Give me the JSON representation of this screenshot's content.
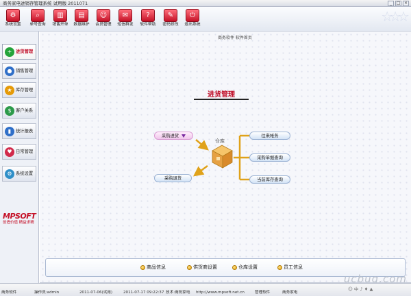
{
  "window": {
    "title": "商务家电进销存管理系统 试用版 2011071",
    "buttons": [
      "_",
      "□",
      "×"
    ]
  },
  "toolbar": {
    "items": [
      {
        "label": "系统设置",
        "icon": "gear-icon",
        "glyph": "⚙"
      },
      {
        "label": "单号查询",
        "icon": "magnifier-icon",
        "glyph": "⌕"
      },
      {
        "label": "销售开单",
        "icon": "chart-icon",
        "glyph": "▥"
      },
      {
        "label": "数据维护",
        "icon": "database-icon",
        "glyph": "▤"
      },
      {
        "label": "会员管理",
        "icon": "members-icon",
        "glyph": "☺"
      },
      {
        "label": "短信群发",
        "icon": "mail-icon",
        "glyph": "✉"
      },
      {
        "label": "软件帮助",
        "icon": "help-icon",
        "glyph": "?"
      },
      {
        "label": "密码修改",
        "icon": "lock-icon",
        "glyph": "✎"
      },
      {
        "label": "退出系统",
        "icon": "power-icon",
        "glyph": "⏻"
      }
    ]
  },
  "sidebar": {
    "items": [
      {
        "label": "进货管理",
        "icon": "plus-icon",
        "glyph": "+",
        "color": "#23a33a",
        "active": true
      },
      {
        "label": "销售管理",
        "icon": "sales-icon",
        "glyph": "●",
        "color": "#2f6fc8",
        "active": false
      },
      {
        "label": "库存管理",
        "icon": "star-icon",
        "glyph": "★",
        "color": "#e59a07",
        "active": false
      },
      {
        "label": "客户关系",
        "icon": "dollar-icon",
        "glyph": "$",
        "color": "#2c9a4a",
        "active": false
      },
      {
        "label": "统计报表",
        "icon": "report-icon",
        "glyph": "▮",
        "color": "#2f6fc8",
        "active": false
      },
      {
        "label": "日常管理",
        "icon": "heart-icon",
        "glyph": "♥",
        "color": "#d12a4b",
        "active": false
      },
      {
        "label": "系统设置",
        "icon": "settings-icon",
        "glyph": "⚙",
        "color": "#2f8fc8",
        "active": false
      }
    ],
    "logo": {
      "brand": "MPSOFT",
      "tagline": "创造价值 精益求精"
    }
  },
  "main": {
    "header": "商务软件 软件首页",
    "title": "进货管理",
    "diagram": {
      "center_label": "仓库",
      "purchase_in": "采购进货",
      "purchase_return": "采购退货",
      "right_items": [
        "往来帐务",
        "采购单据查询",
        "当前库存查询"
      ]
    },
    "bottom_links": [
      "商品信息",
      "供货商设置",
      "仓库设置",
      "员工信息"
    ]
  },
  "statusbar": {
    "cells": [
      "商务软件",
      "操作员:admin",
      "2011-07-06(试用)",
      "2011-07-17 09:22:37",
      "技术:商务家电",
      "http://www.mpsoft.net.cn",
      "管理软件",
      "商务家电"
    ],
    "tray": "☺ 中 ♪ ♦ ▲"
  },
  "watermark": "ucbug.com"
}
